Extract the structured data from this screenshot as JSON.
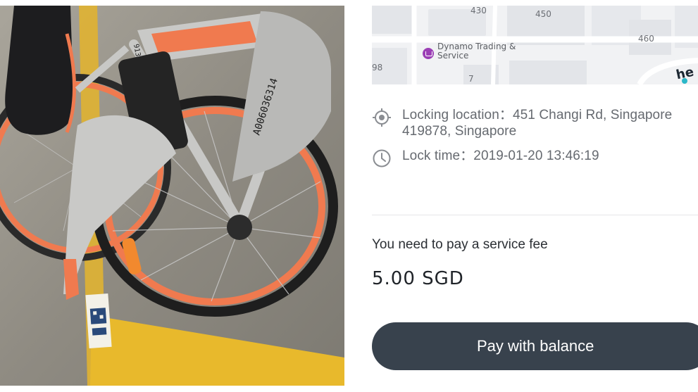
{
  "map": {
    "numbers": [
      "430",
      "450",
      "460",
      "98",
      "7",
      "460"
    ],
    "poi_label": "Dynamo Trading & Service",
    "brand_fragment": "he"
  },
  "photo": {
    "frame_code": "A006036314",
    "frame_code_small": "913"
  },
  "lock_info": {
    "location": "Locking location：451 Changi Rd, Singapore 419878, Singapore",
    "time": "Lock time：2019-01-20 13:46:19"
  },
  "fee": {
    "label": "You need to pay a service fee",
    "amount": "5.00 SGD"
  },
  "actions": {
    "pay_label": "Pay with balance"
  },
  "colors": {
    "button_bg": "#38424d",
    "accent_orange": "#f07a4f",
    "paint_yellow": "#e8b92c"
  }
}
